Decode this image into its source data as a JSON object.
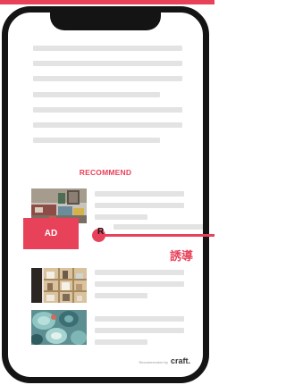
{
  "section_title": "RECOMMEND",
  "ad_label": "AD",
  "callout_marker": "R",
  "callout_label": "誘導",
  "credit": {
    "prefix": "Recommended by",
    "brand": "craft."
  },
  "items": [
    {
      "thumbnail": "living-room-photo"
    },
    {
      "thumbnail": "ad-placeholder"
    },
    {
      "thumbnail": "wooden-shelf-photo"
    },
    {
      "thumbnail": "teal-tableware-photo"
    }
  ],
  "colors": {
    "accent": "#e8425a",
    "bezel": "#141414",
    "placeholder_line": "#e3e3e3"
  }
}
